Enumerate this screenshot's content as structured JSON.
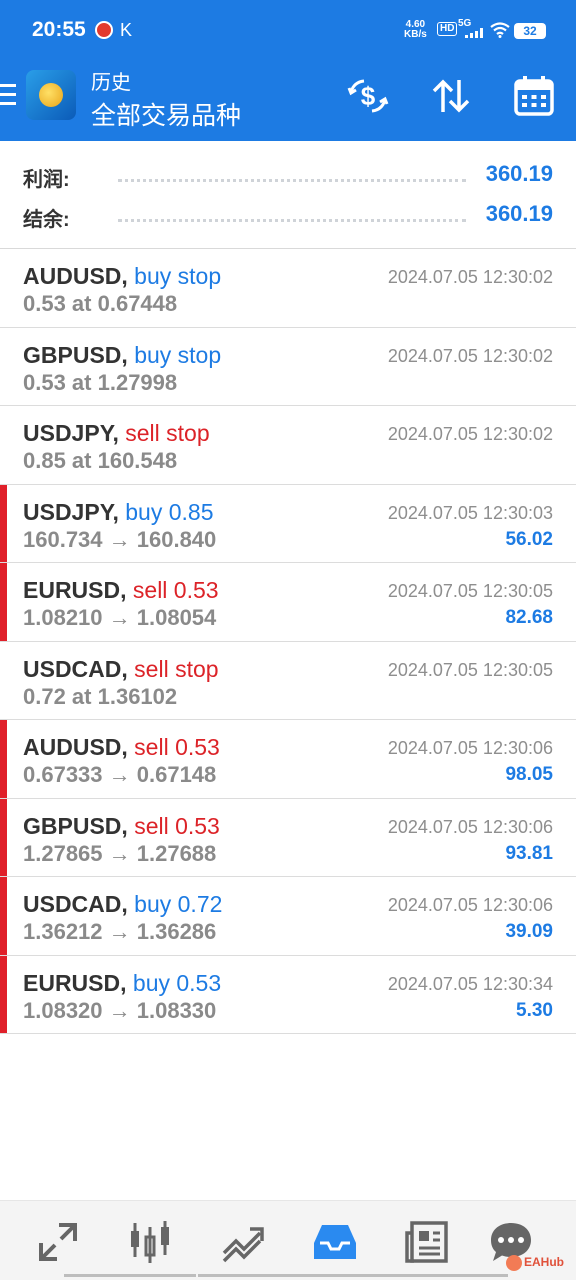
{
  "status_bar": {
    "time": "20:55",
    "notification": "K",
    "network_speed_value": "4.60",
    "network_speed_unit": "KB/s",
    "hd": "HD",
    "signal": "5G",
    "battery": "32"
  },
  "header": {
    "title_small": "历史",
    "title_large": "全部交易品种",
    "icons": [
      "menu-icon",
      "app-logo",
      "dollar-refresh-icon",
      "sort-icon",
      "calendar-icon"
    ]
  },
  "summary": {
    "profit_label": "利润:",
    "profit_value": "360.19",
    "balance_label": "结余:",
    "balance_value": "360.19"
  },
  "trades": [
    {
      "symbol": "AUDUSD,",
      "action": "buy stop",
      "side": "buy",
      "detail": "0.53 at 0.67448",
      "time": "2024.07.05 12:30:02",
      "profit": "",
      "marker": false
    },
    {
      "symbol": "GBPUSD,",
      "action": "buy stop",
      "side": "buy",
      "detail": "0.53 at 1.27998",
      "time": "2024.07.05 12:30:02",
      "profit": "",
      "marker": false
    },
    {
      "symbol": "USDJPY,",
      "action": "sell stop",
      "side": "sell",
      "detail": "0.85 at 160.548",
      "time": "2024.07.05 12:30:02",
      "profit": "",
      "marker": false
    },
    {
      "symbol": "USDJPY,",
      "action": "buy 0.85",
      "side": "buy",
      "detail": "160.734 → 160.840",
      "time": "2024.07.05 12:30:03",
      "profit": "56.02",
      "marker": true
    },
    {
      "symbol": "EURUSD,",
      "action": "sell 0.53",
      "side": "sell",
      "detail": "1.08210 → 1.08054",
      "time": "2024.07.05 12:30:05",
      "profit": "82.68",
      "marker": true
    },
    {
      "symbol": "USDCAD,",
      "action": "sell stop",
      "side": "sell",
      "detail": "0.72 at 1.36102",
      "time": "2024.07.05 12:30:05",
      "profit": "",
      "marker": false
    },
    {
      "symbol": "AUDUSD,",
      "action": "sell 0.53",
      "side": "sell",
      "detail": "0.67333 → 0.67148",
      "time": "2024.07.05 12:30:06",
      "profit": "98.05",
      "marker": true
    },
    {
      "symbol": "GBPUSD,",
      "action": "sell 0.53",
      "side": "sell",
      "detail": "1.27865 → 1.27688",
      "time": "2024.07.05 12:30:06",
      "profit": "93.81",
      "marker": true
    },
    {
      "symbol": "USDCAD,",
      "action": "buy 0.72",
      "side": "buy",
      "detail": "1.36212 → 1.36286",
      "time": "2024.07.05 12:30:06",
      "profit": "39.09",
      "marker": true
    },
    {
      "symbol": "EURUSD,",
      "action": "buy 0.53",
      "side": "buy",
      "detail": "1.08320 → 1.08330",
      "time": "2024.07.05 12:30:34",
      "profit": "5.30",
      "marker": true
    }
  ],
  "bottom_nav": {
    "items": [
      "quotes-icon",
      "chart-icon",
      "trade-icon",
      "history-icon",
      "news-icon",
      "messages-icon"
    ],
    "active": "history-icon",
    "watermark": "EAHub"
  },
  "colors": {
    "header_bg": "#1d7be3",
    "buy": "#1d7be3",
    "sell": "#dc2328",
    "marker": "#e0202a"
  }
}
